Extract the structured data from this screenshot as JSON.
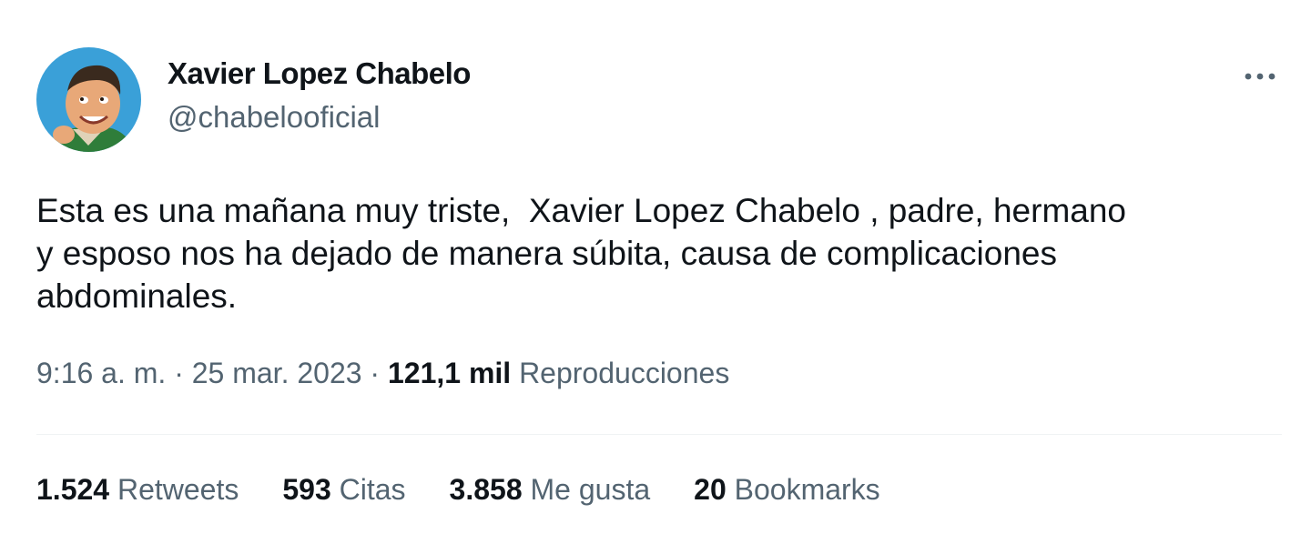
{
  "author": {
    "display_name": "Xavier Lopez Chabelo",
    "handle": "@chabelooficial"
  },
  "more_icon": "more-horizontal-icon",
  "tweet": {
    "text": "Esta es una mañana muy triste,  Xavier Lopez Chabelo , padre, hermano\ny esposo nos ha dejado de manera súbita, causa de complicaciones\nabdominales."
  },
  "meta": {
    "time": "9:16 a. m.",
    "separator": " · ",
    "date": "25 mar. 2023",
    "views_count": "121,1 mil",
    "views_label": "Reproducciones"
  },
  "stats": [
    {
      "count": "1.524",
      "label": "Retweets"
    },
    {
      "count": "593",
      "label": "Citas"
    },
    {
      "count": "3.858",
      "label": "Me gusta"
    },
    {
      "count": "20",
      "label": "Bookmarks"
    }
  ],
  "colors": {
    "text_primary": "#0f1419",
    "text_secondary": "#536471",
    "divider": "#eff3f4",
    "avatar_bg": "#3aa0d8"
  }
}
